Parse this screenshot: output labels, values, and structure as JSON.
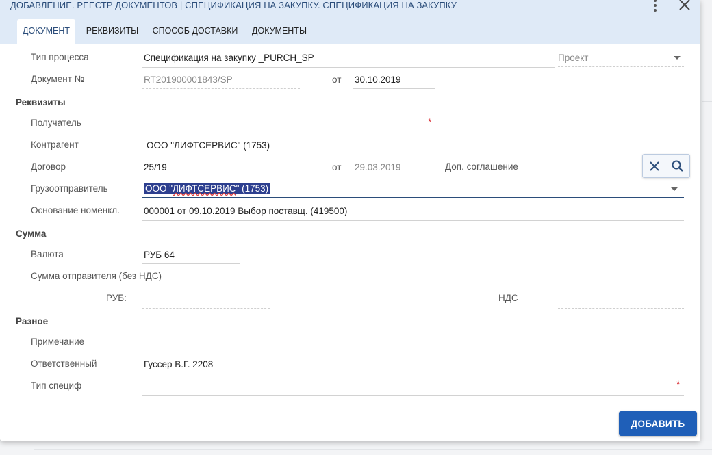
{
  "title": "ДОБАВЛЕНИЕ. РЕЕСТР ДОКУМЕНТОВ | СПЕЦИФИКАЦИЯ НА ЗАКУПКУ. СПЕЦИФИКАЦИЯ НА ЗАКУПКУ",
  "tabs": [
    "ДОКУМЕНТ",
    "РЕКВИЗИТЫ",
    "СПОСОБ ДОСТАВКИ",
    "ДОКУМЕНТЫ"
  ],
  "form": {
    "process_type": {
      "label": "Тип процесса",
      "value": "Спецификация на закупку _PURCH_SP",
      "status": "Проект"
    },
    "document": {
      "label": "Документ №",
      "number": "RT201900001843/SP",
      "from_label": "от",
      "date": "30.10.2019"
    },
    "sections": {
      "requisites": "Реквизиты",
      "sum": "Сумма",
      "misc": "Разное"
    },
    "recipient": {
      "label": "Получатель",
      "value": ""
    },
    "counterparty": {
      "label": "Контрагент",
      "value": "ООО \"ЛИФТСЕРВИС\" (1753)"
    },
    "contract": {
      "label": "Договор",
      "value": "25/19",
      "from_label": "от",
      "date": "29.03.2019",
      "addendum_label": "Доп. соглашение",
      "addendum_value": ""
    },
    "shipper": {
      "label": "Грузоотправитель",
      "value_prefix": "ООО \"",
      "value_word": "ЛИФТСЕРВИС",
      "value_suffix": "\" (1753)"
    },
    "nomenclature_basis": {
      "label": "Основание номенкл.",
      "value": "000001 от 09.10.2019 Выбор поставщ. (419500)"
    },
    "currency": {
      "label": "Валюта",
      "value": "РУБ 64"
    },
    "sender_sum": {
      "label": "Сумма отправителя (без НДС)",
      "currency_label": "РУБ:",
      "vat_label": "НДС"
    },
    "note": {
      "label": "Примечание",
      "value": ""
    },
    "responsible": {
      "label": "Ответственный",
      "value": "Гуссер В.Г. 2208"
    },
    "spec_type": {
      "label": "Тип специф",
      "value": ""
    }
  },
  "required_mark": "*",
  "add_button": "ДОБАВИТЬ",
  "colors": {
    "header_bg": "#dfeaf7",
    "title": "#2b4d7a",
    "primary_button": "#1f5fb8",
    "selection": "#2d3f8f",
    "required": "#d8232a"
  }
}
